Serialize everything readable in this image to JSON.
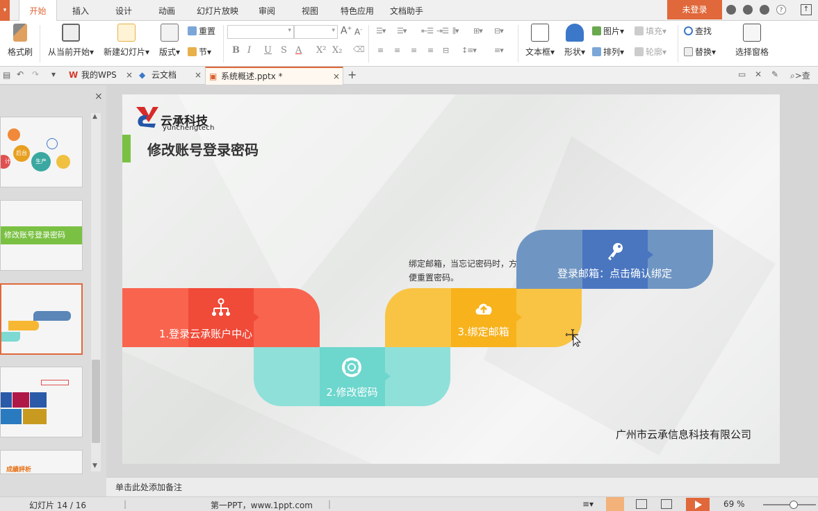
{
  "menu": {
    "tabs": [
      "开始",
      "插入",
      "设计",
      "动画",
      "幻灯片放映",
      "审阅",
      "视图",
      "特色应用",
      "文档助手"
    ],
    "active_tab": "开始",
    "login": "未登录"
  },
  "ribbon": {
    "format_painter": "格式刷",
    "from_current": "从当前开始",
    "new_slide": "新建幻灯片",
    "layout": "版式",
    "reset": "重置",
    "section": "节",
    "textbox": "文本框",
    "shape": "形状",
    "picture": "图片",
    "fill": "填充",
    "arrange": "排列",
    "outline": "轮廓",
    "find": "查找",
    "replace": "替换",
    "select_pane": "选择窗格",
    "font_buttons": [
      "B",
      "I",
      "U",
      "S",
      "A",
      "X²",
      "X₂"
    ]
  },
  "tabs": {
    "doc_tabs": [
      {
        "label": "我的WPS"
      },
      {
        "label": "云文档"
      },
      {
        "label": "系统概述.pptx *"
      }
    ],
    "search_placeholder": ">查"
  },
  "thumbnails": {
    "thumb2_label": "修改账号登录密码",
    "thumb1_bubbles": [
      "后台",
      "生产",
      "计"
    ],
    "thumb5_label": "成績評析"
  },
  "slide": {
    "logo_text": "云承科技",
    "logo_sub": "yunchengtech",
    "title": "修改账号登录密码",
    "steps": [
      {
        "label": "1.登录云承账户中心",
        "color": "#f15a4a",
        "icon": "org-chart-icon"
      },
      {
        "label": "2.修改密码",
        "color": "#7dd9d1",
        "icon": "lifebuoy-icon"
      },
      {
        "label": "3.绑定邮箱",
        "color": "#f7b733",
        "icon": "cloud-upload-icon"
      },
      {
        "label": "登录邮箱：点击确认绑定",
        "color": "#5a86b8",
        "icon": "key-icon"
      }
    ],
    "annotation": "绑定邮箱，当忘记密码时，方便重置密码。",
    "company": "广州市云承信息科技有限公司"
  },
  "notes": {
    "placeholder": "单击此处添加备注"
  },
  "status": {
    "slide_counter": "幻灯片 14 / 16",
    "theme": "第一PPT，www.1ppt.com",
    "zoom": "69 %",
    "zoom_level": 0.69
  },
  "colors": {
    "accent": "#e0683a",
    "title_bar": "#7ac143"
  }
}
